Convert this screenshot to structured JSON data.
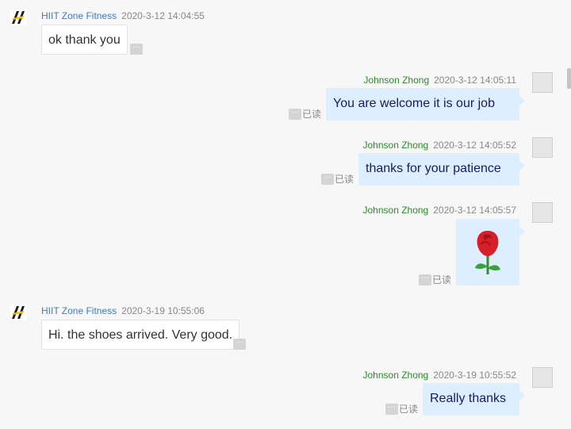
{
  "messages": [
    {
      "sender": "HIIT Zone Fitness",
      "time": "2020-3-12 14:04:55",
      "text": "ok thank you"
    },
    {
      "sender": "Johnson Zhong",
      "time": "2020-3-12 14:05:11",
      "text": "You are welcome it is our job",
      "read": "已读"
    },
    {
      "sender": "Johnson Zhong",
      "time": "2020-3-12 14:05:52",
      "text": "thanks for your patience",
      "read": "已读"
    },
    {
      "sender": "Johnson Zhong",
      "time": "2020-3-12 14:05:57",
      "emoji": "🌹",
      "read": "已读"
    },
    {
      "sender": "HIIT Zone Fitness",
      "time": "2020-3-19 10:55:06",
      "text": "Hi. the shoes arrived. Very good."
    },
    {
      "sender": "Johnson Zhong",
      "time": "2020-3-19 10:55:52",
      "text": "Really thanks",
      "read": "已读"
    }
  ],
  "more_glyph": "···",
  "icons": {
    "shop_avatar": "hiit-logo-icon",
    "user_avatar": "user-avatar-icon",
    "more": "more-options-icon"
  }
}
